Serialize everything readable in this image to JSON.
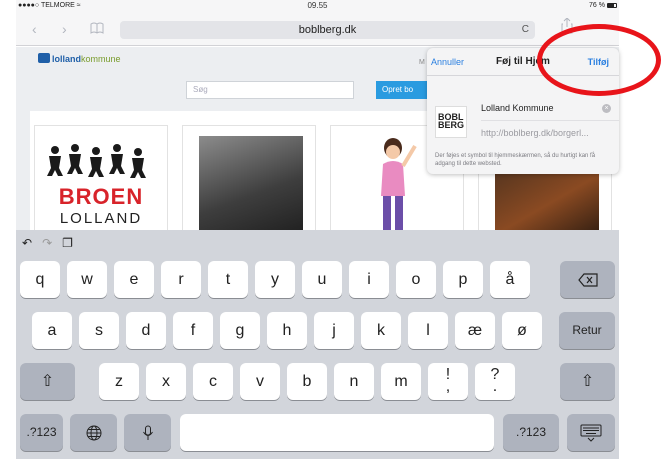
{
  "status": {
    "carrier": "●●●●○ TELMORE ≈",
    "time": "09.55",
    "battery": "76 %"
  },
  "browser": {
    "url": "boblberg.dk",
    "reload": "C"
  },
  "site": {
    "logo_a": "lolland",
    "logo_b": "kommune",
    "search_placeholder": "Søg",
    "create_button": "Opret bo",
    "card1_line1": "BROEN",
    "card1_line2": "LOLLAND"
  },
  "popover": {
    "behind_text": "M",
    "cancel": "Annuller",
    "title": "Føj til Hjem",
    "add": "Tilføj",
    "name_value": "Lolland Kommune",
    "icon_text": "BOBL BERG",
    "url": "http://boblberg.dk/borgerl...",
    "description": "Der føjes et symbol til hjemmeskærmen, så du hurtigt kan få adgang til dette websted."
  },
  "keyboard": {
    "row1": [
      "q",
      "w",
      "e",
      "r",
      "t",
      "y",
      "u",
      "i",
      "o",
      "p",
      "å"
    ],
    "row2": [
      "a",
      "s",
      "d",
      "f",
      "g",
      "h",
      "j",
      "k",
      "l",
      "æ",
      "ø"
    ],
    "row3": [
      "z",
      "x",
      "c",
      "v",
      "b",
      "n",
      "m",
      "!\n,",
      "?\n."
    ],
    "return": "Retur",
    "numbers": ".?123"
  }
}
